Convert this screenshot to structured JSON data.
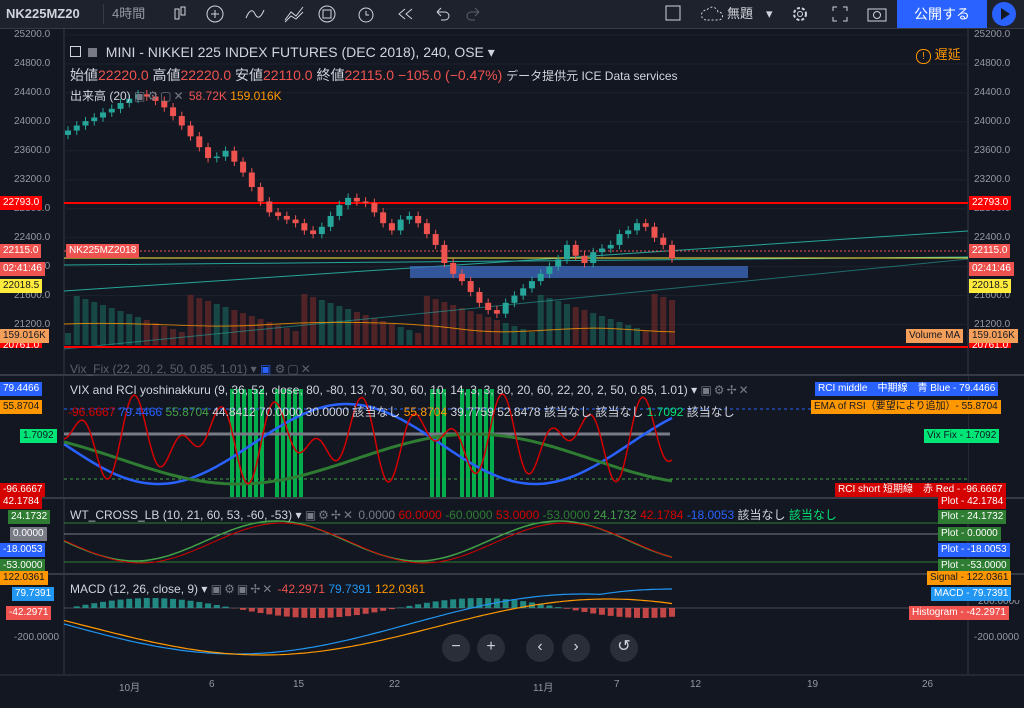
{
  "toolbar": {
    "symbol": "NK225MZ20",
    "interval": "4時間",
    "template_label": "無題",
    "publish_label": "公開する"
  },
  "header": {
    "title": "MINI - NIKKEI 225 INDEX FUTURES (DEC 2018), 240, OSE",
    "delay_label": "遅延",
    "open_label": "始値",
    "open": "22220.0",
    "high_label": "高値",
    "high": "22220.0",
    "low_label": "安値",
    "low": "22110.0",
    "close_label": "終値",
    "close": "22115.0",
    "change": "−105.0 (−0.47%)",
    "data_provider": "データ提供元 ICE Data services",
    "volume_label": "出来高 (20)",
    "volume_value": "58.72K",
    "volume_ma": "159.016K"
  },
  "price_axis": [
    "25200.0",
    "24800.0",
    "24400.0",
    "24000.0",
    "23600.0",
    "23200.0",
    "22800.0",
    "22400.0",
    "22000.0",
    "21600.0",
    "21200.0"
  ],
  "price_badges": {
    "resistance": "22793.0",
    "last_symbol": "NK225MZ2018",
    "last": "22115.0",
    "countdown": "02:41:46",
    "yellow_line": "22018.5",
    "volume_ma_label": "Volume MA",
    "volume_ma_value": "159.016K",
    "cut_off": "20761.0"
  },
  "vix_pane": {
    "title": "Vix_Fix (22, 20, 2, 50, 0.85, 1.01)",
    "rci_title": "VIX and RCI yoshinakkuru (9, 36, 52, close, 80, -80, 13, 70, 30, 60, 10, 14, 3, 3, 80, 20, 60, 22, 20, 2, 50, 0.85, 1.01)",
    "values": [
      "-96.6667",
      "79.4466",
      "55.8704",
      "44.8412",
      "70.0000",
      "30.0000",
      "該当なし",
      "55.8704",
      "39.7759",
      "52.8478",
      "該当なし",
      "該当なし",
      "1.7092",
      "該当なし"
    ],
    "left_badges": [
      "79.4466",
      "55.8704",
      "1.7092",
      "-96.6667"
    ],
    "right_badges": [
      "RCI middle　中期線　青 Blue - 79.4466",
      "EMA of RSI（要望により追加）- 55.8704",
      "Vix Fix - 1.7092",
      "RCI short 短期線　赤 Red - -96.6667"
    ]
  },
  "wt_pane": {
    "title": "WT_CROSS_LB (10, 21, 60, 53, -60, -53)",
    "values": [
      "0.0000",
      "60.0000",
      "-60.0000",
      "53.0000",
      "-53.0000",
      "24.1732",
      "42.1784",
      "-18.0053",
      "該当なし",
      "該当なし"
    ],
    "left_badges": [
      "42.1784",
      "24.1732",
      "0.0000",
      "-18.0053",
      "-53.0000"
    ],
    "right_badges": [
      "Plot - 42.1784",
      "Plot - 24.1732",
      "Plot - 0.0000",
      "Plot - -18.0053",
      "Plot - -53.0000"
    ]
  },
  "macd_pane": {
    "title": "MACD (12, 26, close, 9)",
    "values": [
      "-42.2971",
      "79.7391",
      "122.0361"
    ],
    "left_badges": [
      "122.0361",
      "79.7391",
      "-42.2971"
    ],
    "right_badges": [
      "Signal - 122.0361",
      "MACD - 79.7391",
      "Histogram - -42.2971"
    ],
    "axis": [
      "200.0000",
      "-200.0000"
    ],
    "axis_partial": "0.0000"
  },
  "time_axis": [
    "10月",
    "6",
    "15",
    "22",
    "11月",
    "7",
    "12",
    "19",
    "26"
  ],
  "nav_buttons": [
    "−",
    "+",
    "‹",
    "›",
    "↺"
  ],
  "chart_data": {
    "type": "candlestick",
    "title": "MINI - NIKKEI 225 INDEX FUTURES (DEC 2018), 240, OSE",
    "ylim": [
      21000,
      25300
    ],
    "x_ticks": [
      "10月",
      "6",
      "15",
      "22",
      "11月",
      "7",
      "12",
      "19",
      "26"
    ],
    "closes": [
      23880,
      23950,
      24010,
      24060,
      24130,
      24180,
      24260,
      24320,
      24380,
      24350,
      24290,
      24200,
      24080,
      23950,
      23800,
      23650,
      23500,
      23520,
      23600,
      23450,
      23300,
      23100,
      22900,
      22750,
      22700,
      22650,
      22600,
      22500,
      22450,
      22550,
      22700,
      22850,
      22950,
      22900,
      22880,
      22750,
      22600,
      22500,
      22650,
      22700,
      22600,
      22450,
      22300,
      22050,
      21900,
      21800,
      21650,
      21500,
      21400,
      21350,
      21500,
      21600,
      21700,
      21800,
      21900,
      22000,
      22100,
      22300,
      22150,
      22050,
      22200,
      22250,
      22300,
      22450,
      22500,
      22600,
      22550,
      22400,
      22300,
      22115
    ],
    "volume_ma": "159.016K",
    "hlines": {
      "resistance": 22793.0,
      "yellow": 22018.5
    },
    "colors": {
      "up": "#26a69a",
      "down": "#ef5350"
    }
  }
}
